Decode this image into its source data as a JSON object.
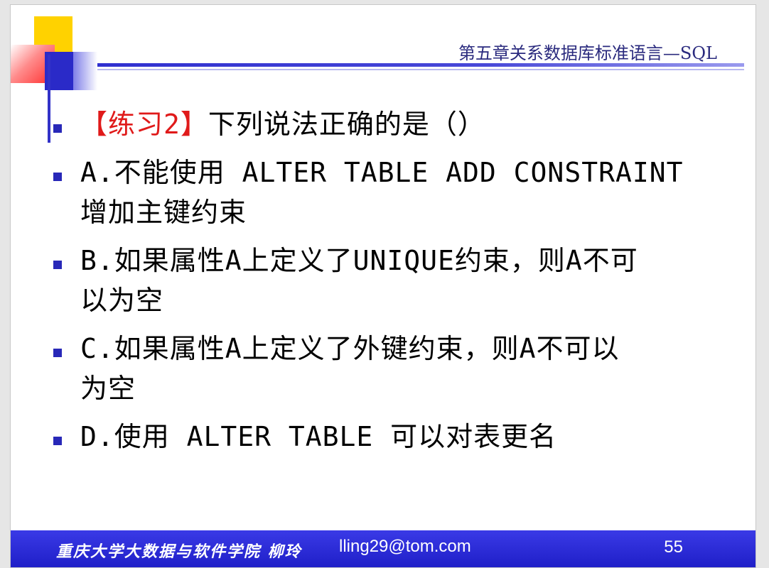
{
  "header": {
    "chapter_title": "第五章关系数据库标准语言—SQL"
  },
  "question": {
    "tag": "【练习2】",
    "text": "下列说法正确的是（）"
  },
  "options": [
    {
      "line1": "A.不能使用 ALTER TABLE ADD CONSTRAINT",
      "line2": "增加主键约束"
    },
    {
      "line1": "B.如果属性A上定义了UNIQUE约束，则A不可",
      "line2": "以为空"
    },
    {
      "line1": "C.如果属性A上定义了外键约束，则A不可以",
      "line2": "为空"
    },
    {
      "line1": "D.使用 ALTER TABLE 可以对表更名",
      "line2": ""
    }
  ],
  "footer": {
    "school": "重庆大学大数据与软件学院 柳玲",
    "email": "lling29@tom.com",
    "page_number": "55"
  },
  "colors": {
    "bullet": "#2828b8",
    "exercise_tag": "#e01a1a",
    "footer_bar": "#2626d2",
    "chapter_title": "#2a2a7e"
  }
}
